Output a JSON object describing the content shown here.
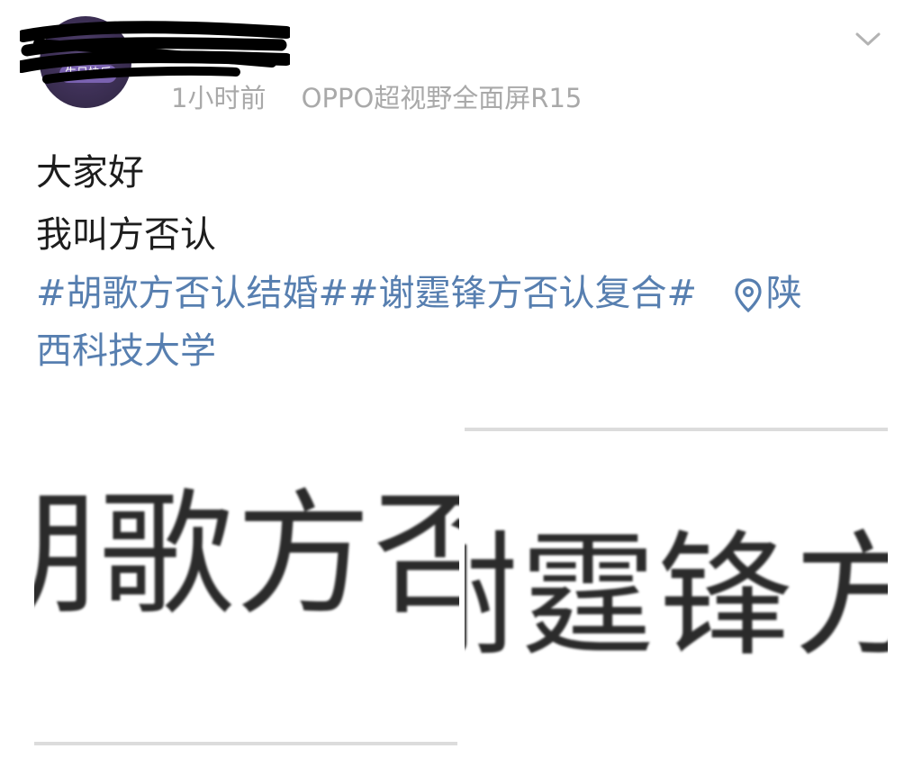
{
  "post": {
    "avatar_badge": "生日快乐",
    "meta": {
      "time": "1小时前",
      "device": "OPPO超视野全面屏R15"
    },
    "lines": [
      "大家好",
      "我叫方否认"
    ],
    "topics": [
      "#胡歌方否认结婚#",
      "#谢霆锋方否认复合#"
    ],
    "location": {
      "line1": "陕",
      "line2": "西科技大学"
    }
  },
  "zoom": {
    "left_text": "胡歌方否",
    "right_text": "谢霆锋方"
  },
  "icons": {
    "menu": "chevron-down-icon",
    "location": "location-pin-icon"
  },
  "colors": {
    "link": "#577fb0",
    "meta": "#a9a9a9",
    "text": "#1d1d1d"
  }
}
